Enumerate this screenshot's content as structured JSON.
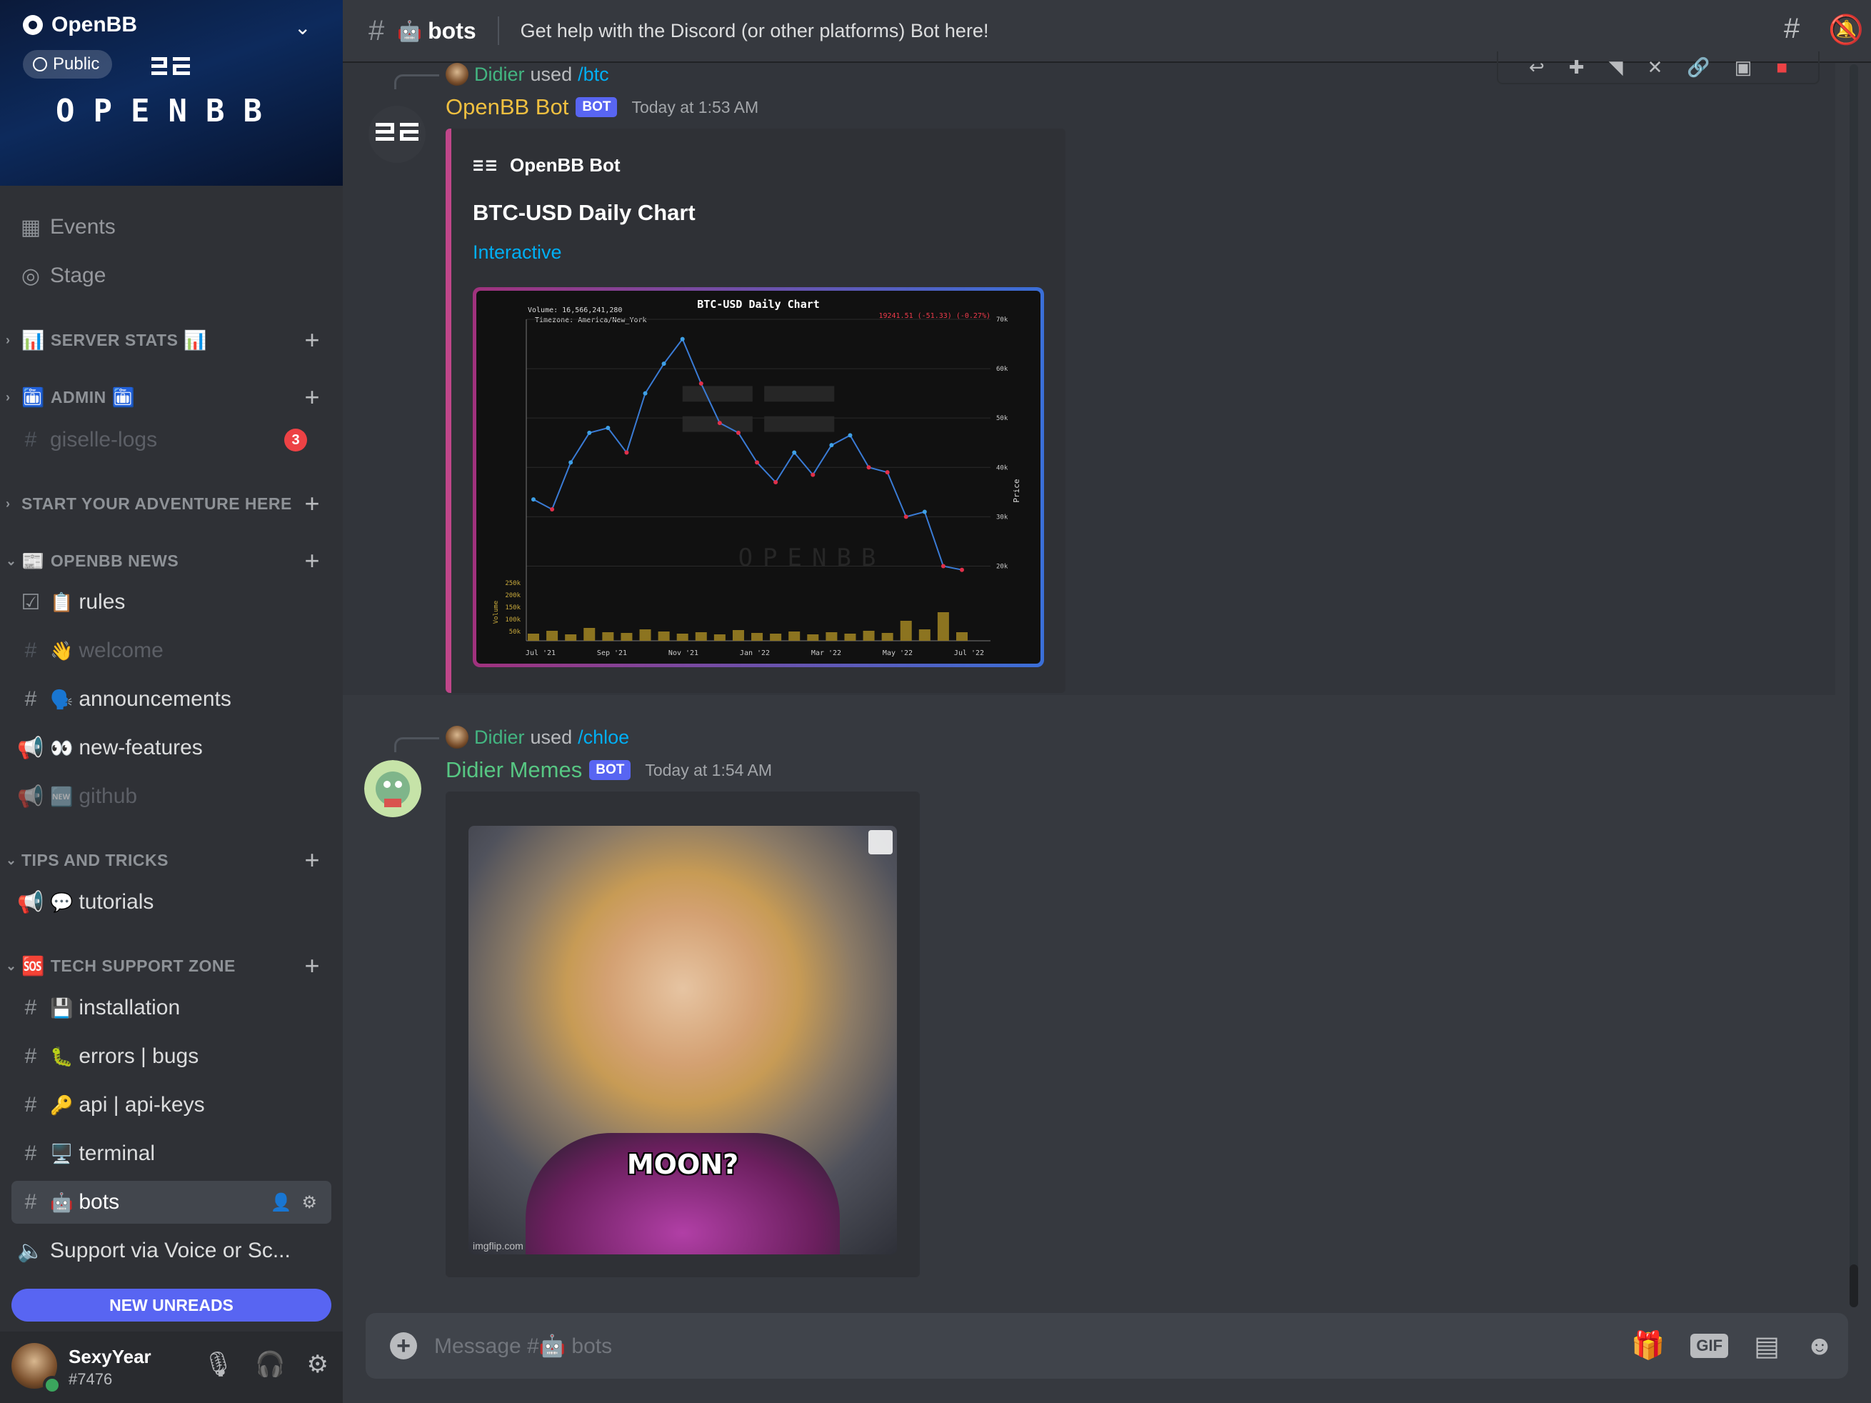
{
  "server": {
    "name": "OpenBB",
    "visibility": "Public",
    "banner_text": "OPENBB"
  },
  "sidebar": {
    "top_items": [
      {
        "label": "Events",
        "icon": "calendar-icon"
      },
      {
        "label": "Stage",
        "icon": "stage-icon"
      }
    ],
    "categories": {
      "server_stats": "SERVER STATS",
      "admin": "ADMIN",
      "start_adventure": "START YOUR ADVENTURE HERE",
      "openbb_news": "OPENBB NEWS",
      "tips": "TIPS AND TRICKS",
      "tech_support": "TECH SUPPORT ZONE"
    },
    "channels": {
      "giselle_logs": {
        "label": "giselle-logs",
        "badge": "3"
      },
      "rules": {
        "emoji": "📋",
        "label": "rules"
      },
      "welcome": {
        "emoji": "👋",
        "label": "welcome"
      },
      "announcements": {
        "emoji": "🗣️",
        "label": "announcements"
      },
      "new_features": {
        "emoji": "👀",
        "label": "new-features"
      },
      "github": {
        "emoji": "🆕",
        "label": "github"
      },
      "tutorials": {
        "emoji": "💬",
        "label": "tutorials"
      },
      "installation": {
        "emoji": "💾",
        "label": "installation"
      },
      "errors": {
        "emoji": "🐛",
        "label": "errors | bugs"
      },
      "api": {
        "emoji": "🔑",
        "label": "api | api-keys"
      },
      "terminal": {
        "emoji": "🖥️",
        "label": "terminal"
      },
      "bots": {
        "emoji": "🤖",
        "label": "bots"
      },
      "support_voice": {
        "label": "Support via Voice or Sc..."
      }
    },
    "new_unreads": "NEW UNREADS"
  },
  "user": {
    "name": "SexyYear",
    "tag": "#7476"
  },
  "header": {
    "channel_emoji": "🤖",
    "channel_name": "bots",
    "topic": "Get help with the Discord (or other platforms) Bot here!"
  },
  "messages": [
    {
      "reply_user": "Didier",
      "reply_used": "used",
      "reply_command": "/btc",
      "author": "OpenBB Bot",
      "author_color": "#f0c040",
      "bot_tag": "BOT",
      "timestamp": "Today at 1:53 AM",
      "embed": {
        "author": "OpenBB Bot",
        "title": "BTC-USD Daily Chart",
        "link": "Interactive",
        "border_color": "#c0468a"
      }
    },
    {
      "reply_user": "Didier",
      "reply_used": "used",
      "reply_command": "/chloe",
      "author": "Didier Memes",
      "author_color": "#57c783",
      "bot_tag": "BOT",
      "timestamp": "Today at 1:54 AM",
      "image_caption": "MOON?",
      "image_watermark": "imgflip.com"
    }
  ],
  "composer": {
    "placeholder": "Message #🤖 bots"
  },
  "chart_data": {
    "type": "line",
    "title": "BTC-USD Daily Chart",
    "annotations": [
      "Volume: 16,566,241,280",
      "Timezone: America/New_York",
      "19241.51 (-51.33) (-0.27%)"
    ],
    "ylabel": "Price",
    "volume_label": "Volume",
    "x_ticks": [
      "Jul '21",
      "Sep '21",
      "Nov '21",
      "Jan '22",
      "Mar '22",
      "May '22",
      "Jul '22"
    ],
    "y_ticks": [
      "70k",
      "60k",
      "50k",
      "40k",
      "30k",
      "20k"
    ],
    "volume_ticks": [
      "250k",
      "200k",
      "150k",
      "100k",
      "50k"
    ],
    "ylim": [
      15000,
      70000
    ],
    "watermark": "OPENBB",
    "series": [
      {
        "x": [
          "Jul '21",
          "Aug '21",
          "Aug '21",
          "Sep '21",
          "Sep '21",
          "Oct '21",
          "Oct '21",
          "Nov '21",
          "Nov '21",
          "Dec '21",
          "Dec '21",
          "Jan '22",
          "Jan '22",
          "Feb '22",
          "Feb '22",
          "Mar '22",
          "Mar '22",
          "Apr '22",
          "Apr '22",
          "May '22",
          "May '22",
          "Jun '22",
          "Jun '22",
          "Jul '22"
        ],
        "values": [
          33500,
          31500,
          41000,
          47000,
          48000,
          43000,
          55000,
          61000,
          66000,
          57000,
          49000,
          47000,
          41000,
          37000,
          43000,
          38500,
          44500,
          46500,
          40000,
          39000,
          30000,
          31000,
          20000,
          19241
        ]
      }
    ]
  }
}
